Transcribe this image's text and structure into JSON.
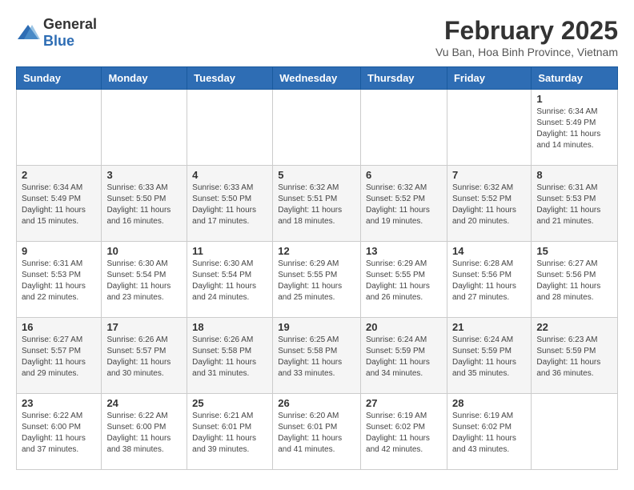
{
  "header": {
    "logo_general": "General",
    "logo_blue": "Blue",
    "month_year": "February 2025",
    "location": "Vu Ban, Hoa Binh Province, Vietnam"
  },
  "weekdays": [
    "Sunday",
    "Monday",
    "Tuesday",
    "Wednesday",
    "Thursday",
    "Friday",
    "Saturday"
  ],
  "weeks": [
    [
      {
        "day": "",
        "info": ""
      },
      {
        "day": "",
        "info": ""
      },
      {
        "day": "",
        "info": ""
      },
      {
        "day": "",
        "info": ""
      },
      {
        "day": "",
        "info": ""
      },
      {
        "day": "",
        "info": ""
      },
      {
        "day": "1",
        "info": "Sunrise: 6:34 AM\nSunset: 5:49 PM\nDaylight: 11 hours and 14 minutes."
      }
    ],
    [
      {
        "day": "2",
        "info": "Sunrise: 6:34 AM\nSunset: 5:49 PM\nDaylight: 11 hours and 15 minutes."
      },
      {
        "day": "3",
        "info": "Sunrise: 6:33 AM\nSunset: 5:50 PM\nDaylight: 11 hours and 16 minutes."
      },
      {
        "day": "4",
        "info": "Sunrise: 6:33 AM\nSunset: 5:50 PM\nDaylight: 11 hours and 17 minutes."
      },
      {
        "day": "5",
        "info": "Sunrise: 6:32 AM\nSunset: 5:51 PM\nDaylight: 11 hours and 18 minutes."
      },
      {
        "day": "6",
        "info": "Sunrise: 6:32 AM\nSunset: 5:52 PM\nDaylight: 11 hours and 19 minutes."
      },
      {
        "day": "7",
        "info": "Sunrise: 6:32 AM\nSunset: 5:52 PM\nDaylight: 11 hours and 20 minutes."
      },
      {
        "day": "8",
        "info": "Sunrise: 6:31 AM\nSunset: 5:53 PM\nDaylight: 11 hours and 21 minutes."
      }
    ],
    [
      {
        "day": "9",
        "info": "Sunrise: 6:31 AM\nSunset: 5:53 PM\nDaylight: 11 hours and 22 minutes."
      },
      {
        "day": "10",
        "info": "Sunrise: 6:30 AM\nSunset: 5:54 PM\nDaylight: 11 hours and 23 minutes."
      },
      {
        "day": "11",
        "info": "Sunrise: 6:30 AM\nSunset: 5:54 PM\nDaylight: 11 hours and 24 minutes."
      },
      {
        "day": "12",
        "info": "Sunrise: 6:29 AM\nSunset: 5:55 PM\nDaylight: 11 hours and 25 minutes."
      },
      {
        "day": "13",
        "info": "Sunrise: 6:29 AM\nSunset: 5:55 PM\nDaylight: 11 hours and 26 minutes."
      },
      {
        "day": "14",
        "info": "Sunrise: 6:28 AM\nSunset: 5:56 PM\nDaylight: 11 hours and 27 minutes."
      },
      {
        "day": "15",
        "info": "Sunrise: 6:27 AM\nSunset: 5:56 PM\nDaylight: 11 hours and 28 minutes."
      }
    ],
    [
      {
        "day": "16",
        "info": "Sunrise: 6:27 AM\nSunset: 5:57 PM\nDaylight: 11 hours and 29 minutes."
      },
      {
        "day": "17",
        "info": "Sunrise: 6:26 AM\nSunset: 5:57 PM\nDaylight: 11 hours and 30 minutes."
      },
      {
        "day": "18",
        "info": "Sunrise: 6:26 AM\nSunset: 5:58 PM\nDaylight: 11 hours and 31 minutes."
      },
      {
        "day": "19",
        "info": "Sunrise: 6:25 AM\nSunset: 5:58 PM\nDaylight: 11 hours and 33 minutes."
      },
      {
        "day": "20",
        "info": "Sunrise: 6:24 AM\nSunset: 5:59 PM\nDaylight: 11 hours and 34 minutes."
      },
      {
        "day": "21",
        "info": "Sunrise: 6:24 AM\nSunset: 5:59 PM\nDaylight: 11 hours and 35 minutes."
      },
      {
        "day": "22",
        "info": "Sunrise: 6:23 AM\nSunset: 5:59 PM\nDaylight: 11 hours and 36 minutes."
      }
    ],
    [
      {
        "day": "23",
        "info": "Sunrise: 6:22 AM\nSunset: 6:00 PM\nDaylight: 11 hours and 37 minutes."
      },
      {
        "day": "24",
        "info": "Sunrise: 6:22 AM\nSunset: 6:00 PM\nDaylight: 11 hours and 38 minutes."
      },
      {
        "day": "25",
        "info": "Sunrise: 6:21 AM\nSunset: 6:01 PM\nDaylight: 11 hours and 39 minutes."
      },
      {
        "day": "26",
        "info": "Sunrise: 6:20 AM\nSunset: 6:01 PM\nDaylight: 11 hours and 41 minutes."
      },
      {
        "day": "27",
        "info": "Sunrise: 6:19 AM\nSunset: 6:02 PM\nDaylight: 11 hours and 42 minutes."
      },
      {
        "day": "28",
        "info": "Sunrise: 6:19 AM\nSunset: 6:02 PM\nDaylight: 11 hours and 43 minutes."
      },
      {
        "day": "",
        "info": ""
      }
    ]
  ]
}
